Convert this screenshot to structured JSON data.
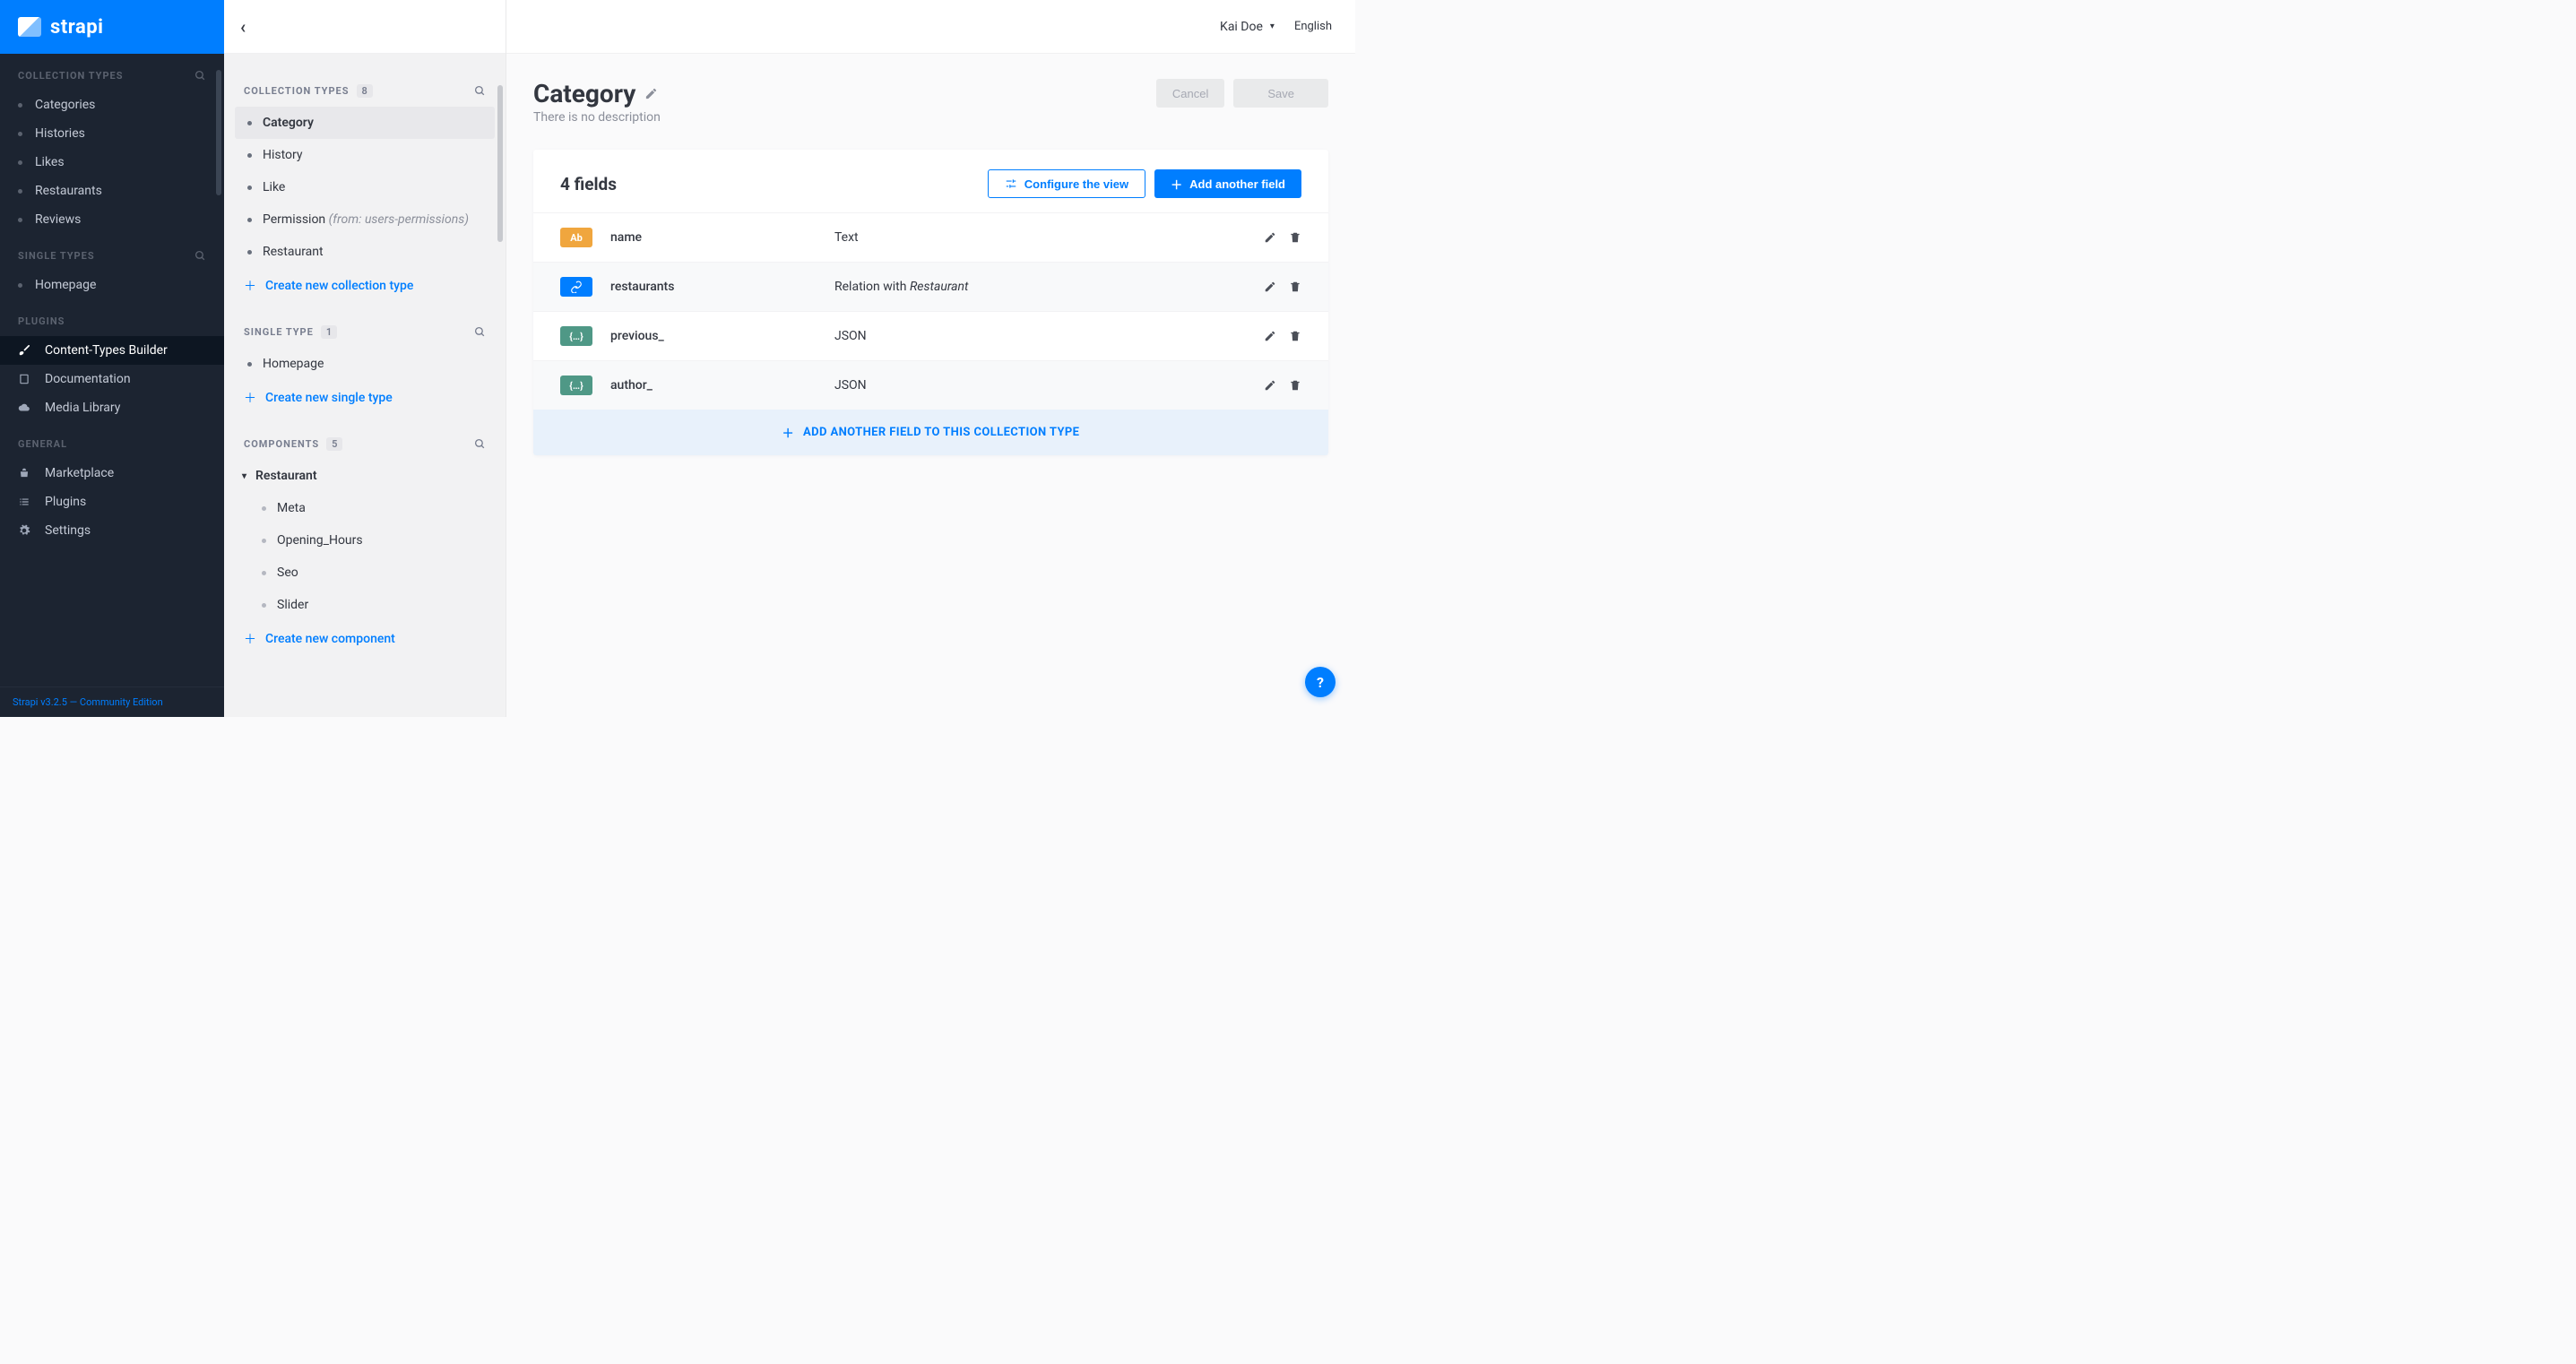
{
  "brand": "strapi",
  "topbar": {
    "user_name": "Kai Doe",
    "language": "English"
  },
  "sidebar_dark": {
    "collection_types_title": "COLLECTION TYPES",
    "collection_types": [
      {
        "label": "Categories"
      },
      {
        "label": "Histories"
      },
      {
        "label": "Likes"
      },
      {
        "label": "Restaurants"
      },
      {
        "label": "Reviews"
      }
    ],
    "single_types_title": "SINGLE TYPES",
    "single_types": [
      {
        "label": "Homepage"
      }
    ],
    "plugins_title": "PLUGINS",
    "plugins": [
      {
        "icon": "brush",
        "label": "Content-Types Builder",
        "active": true
      },
      {
        "icon": "book",
        "label": "Documentation"
      },
      {
        "icon": "cloud",
        "label": "Media Library"
      }
    ],
    "general_title": "GENERAL",
    "general": [
      {
        "icon": "basket",
        "label": "Marketplace"
      },
      {
        "icon": "list",
        "label": "Plugins"
      },
      {
        "icon": "gear",
        "label": "Settings"
      }
    ],
    "footer": "Strapi v3.2.5 — Community Edition"
  },
  "sidebar_light": {
    "collection_types": {
      "title": "COLLECTION TYPES",
      "count": "8",
      "items": [
        {
          "label": "Category",
          "active": true
        },
        {
          "label": "History"
        },
        {
          "label": "Like"
        },
        {
          "label": "Permission",
          "from": "(from: users-permissions)"
        },
        {
          "label": "Restaurant"
        }
      ],
      "add_label": "Create new collection type"
    },
    "single_type": {
      "title": "SINGLE TYPE",
      "count": "1",
      "items": [
        {
          "label": "Homepage"
        }
      ],
      "add_label": "Create new single type"
    },
    "components": {
      "title": "COMPONENTS",
      "count": "5",
      "group": "Restaurant",
      "items": [
        {
          "label": "Meta"
        },
        {
          "label": "Opening_Hours"
        },
        {
          "label": "Seo"
        },
        {
          "label": "Slider"
        }
      ],
      "add_label": "Create new component"
    }
  },
  "page": {
    "title": "Category",
    "subtitle": "There is no description",
    "cancel_label": "Cancel",
    "save_label": "Save",
    "fields_count_label": "4 fields",
    "configure_label": "Configure the view",
    "add_field_label": "Add another field",
    "banner_label": "ADD ANOTHER FIELD TO THIS COLLECTION TYPE",
    "fields": [
      {
        "badge_text": "Ab",
        "badge_class": "text",
        "name": "name",
        "type": "Text"
      },
      {
        "badge_text": "",
        "badge_class": "relation",
        "name": "restaurants",
        "type_prefix": "Relation with ",
        "type_italic": "Restaurant"
      },
      {
        "badge_text": "{…}",
        "badge_class": "json",
        "name": "previous_",
        "type": "JSON"
      },
      {
        "badge_text": "{…}",
        "badge_class": "json",
        "name": "author_",
        "type": "JSON"
      }
    ]
  }
}
